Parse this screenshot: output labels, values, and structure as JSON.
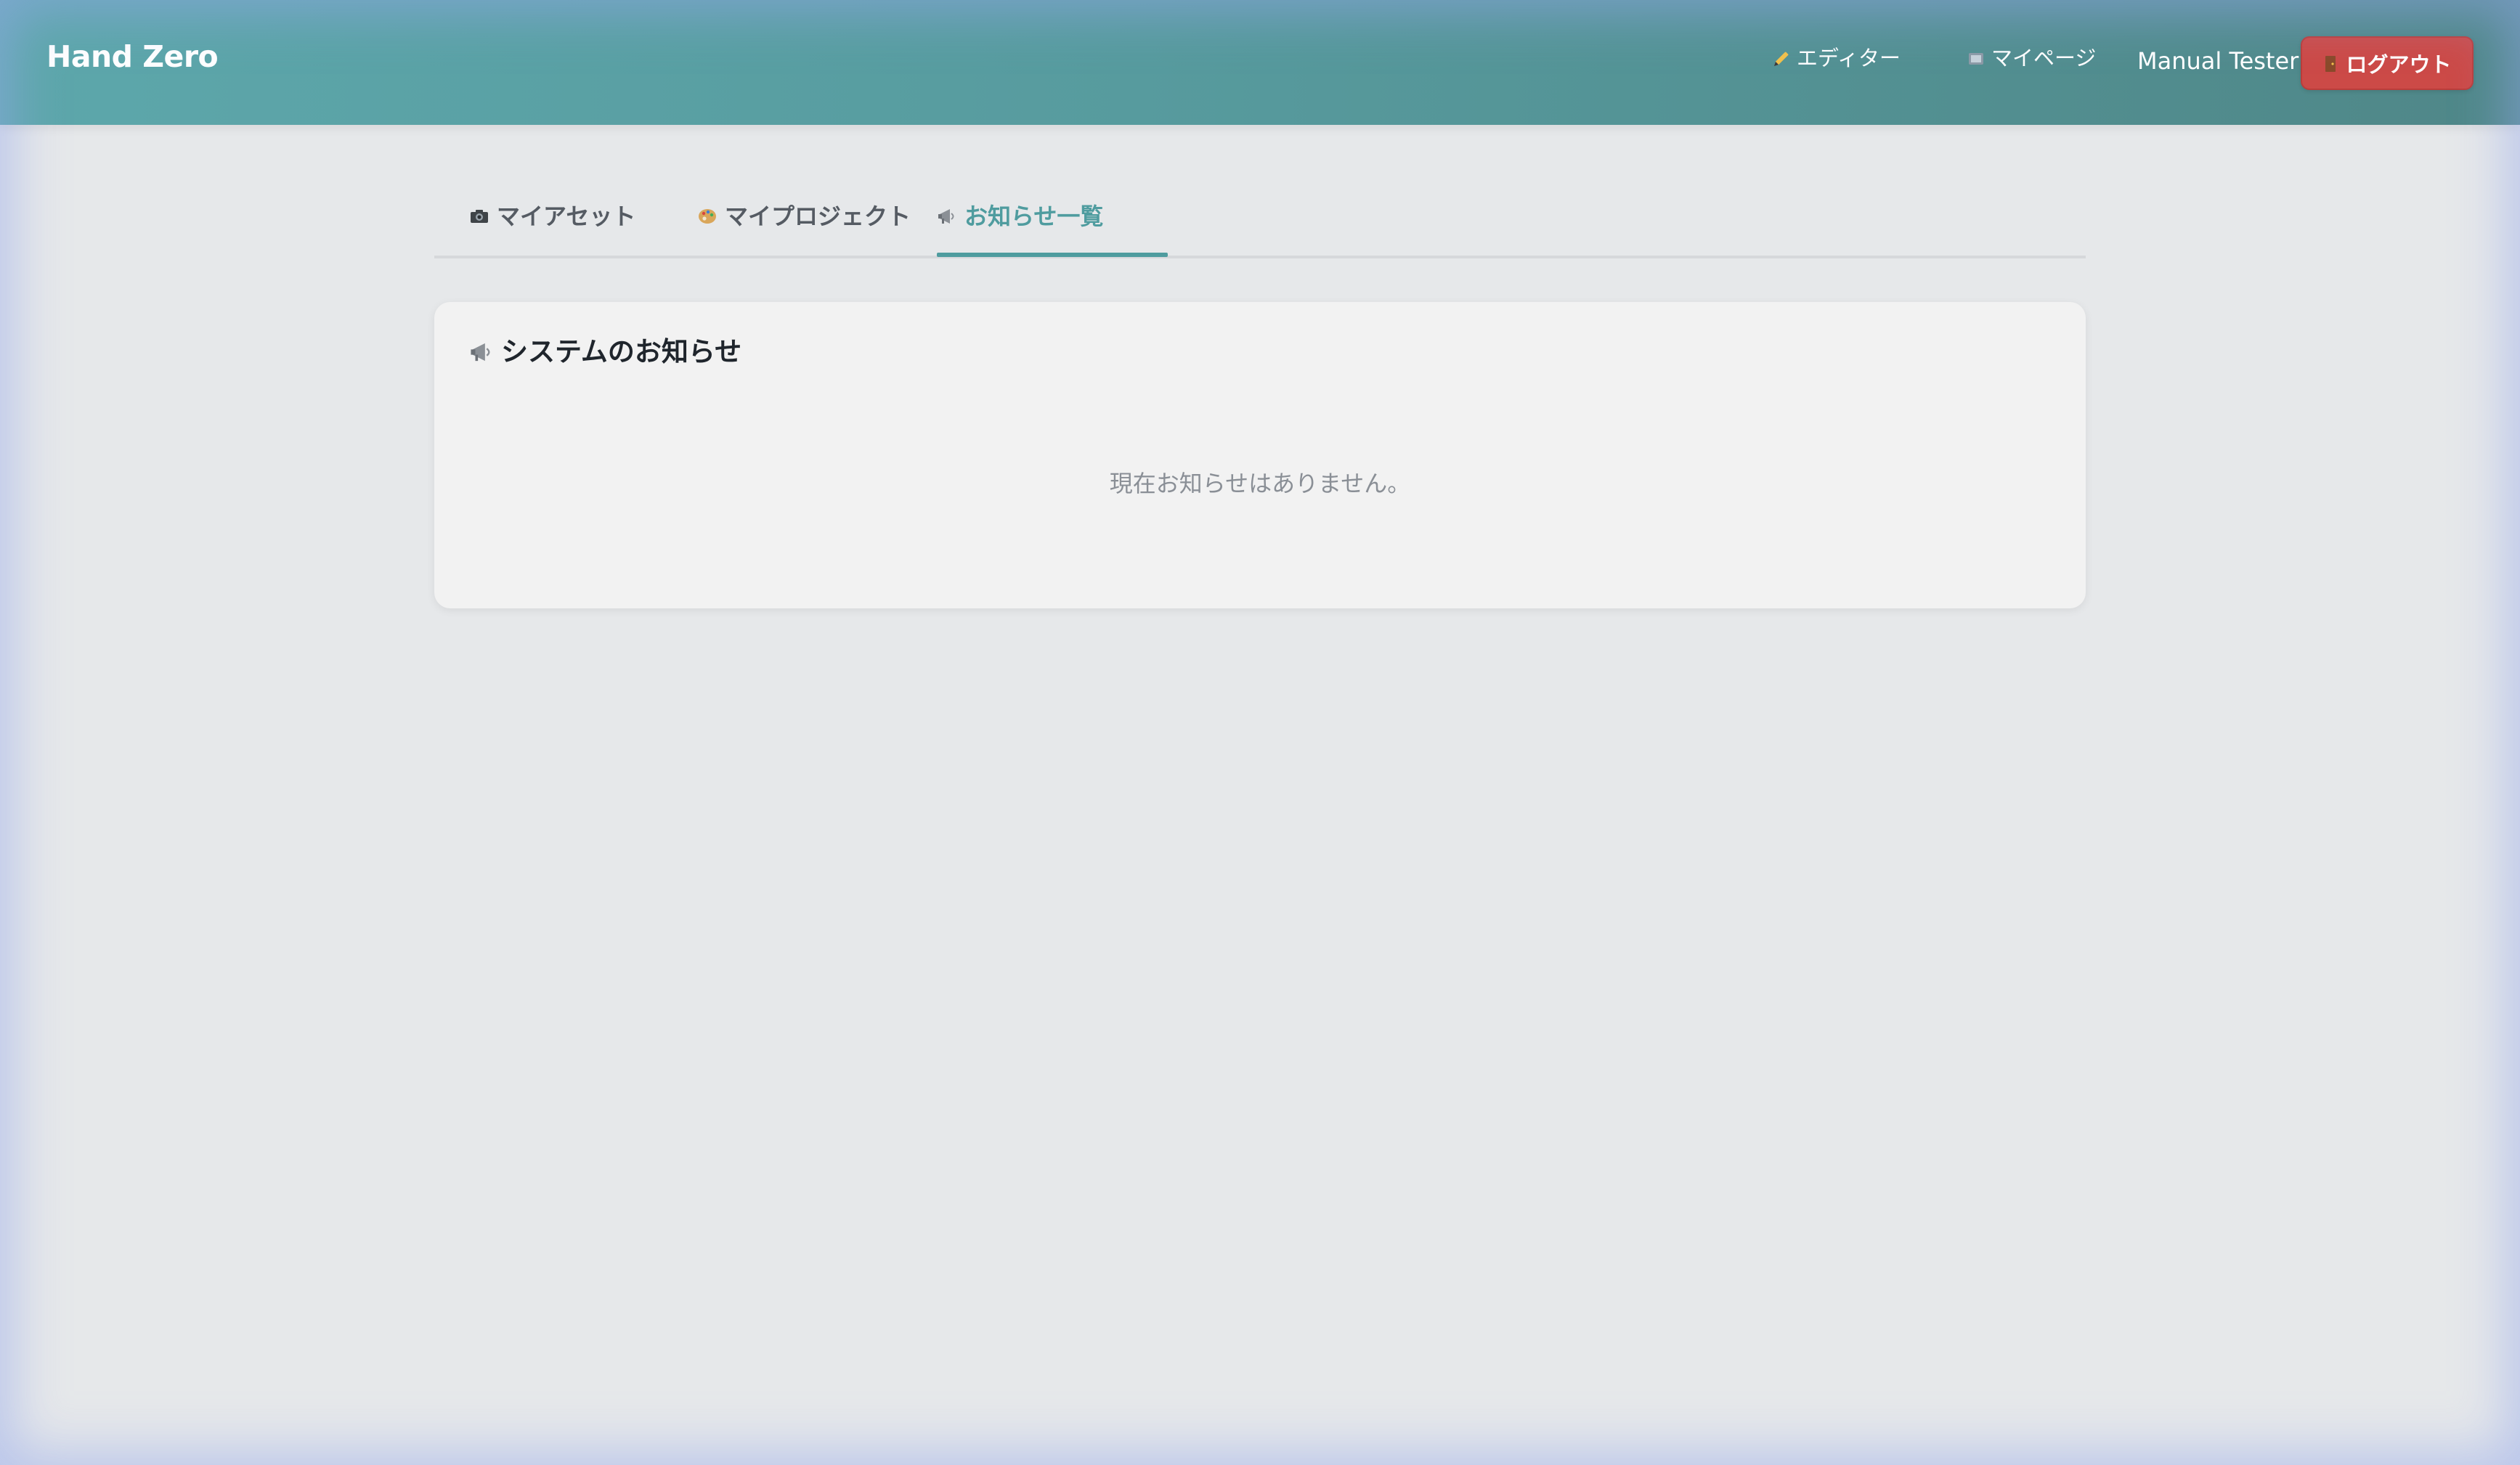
{
  "header": {
    "brand": "Hand Zero",
    "nav": {
      "editor": {
        "icon": "pencil-icon",
        "label": "エディター"
      },
      "mypage": {
        "icon": "map-icon",
        "label": "マイページ"
      }
    },
    "user_name": "Manual Tester",
    "logout": {
      "icon": "door-icon",
      "label": "ログアウト",
      "color": "#cc4a47"
    }
  },
  "tabs": [
    {
      "icon": "camera-icon",
      "label": "マイアセット",
      "active": false
    },
    {
      "icon": "palette-icon",
      "label": "マイプロジェクト",
      "active": false
    },
    {
      "icon": "megaphone-icon",
      "label": "お知らせ一覧",
      "active": true
    }
  ],
  "notices": {
    "title_icon": "megaphone-icon",
    "title": "システムのお知らせ",
    "empty_message": "現在お知らせはありません。"
  },
  "colors": {
    "header_start": "#5da7ab",
    "header_end": "#4f8788",
    "accent": "#4f9c9f",
    "page_bg": "#e6e8ea"
  }
}
